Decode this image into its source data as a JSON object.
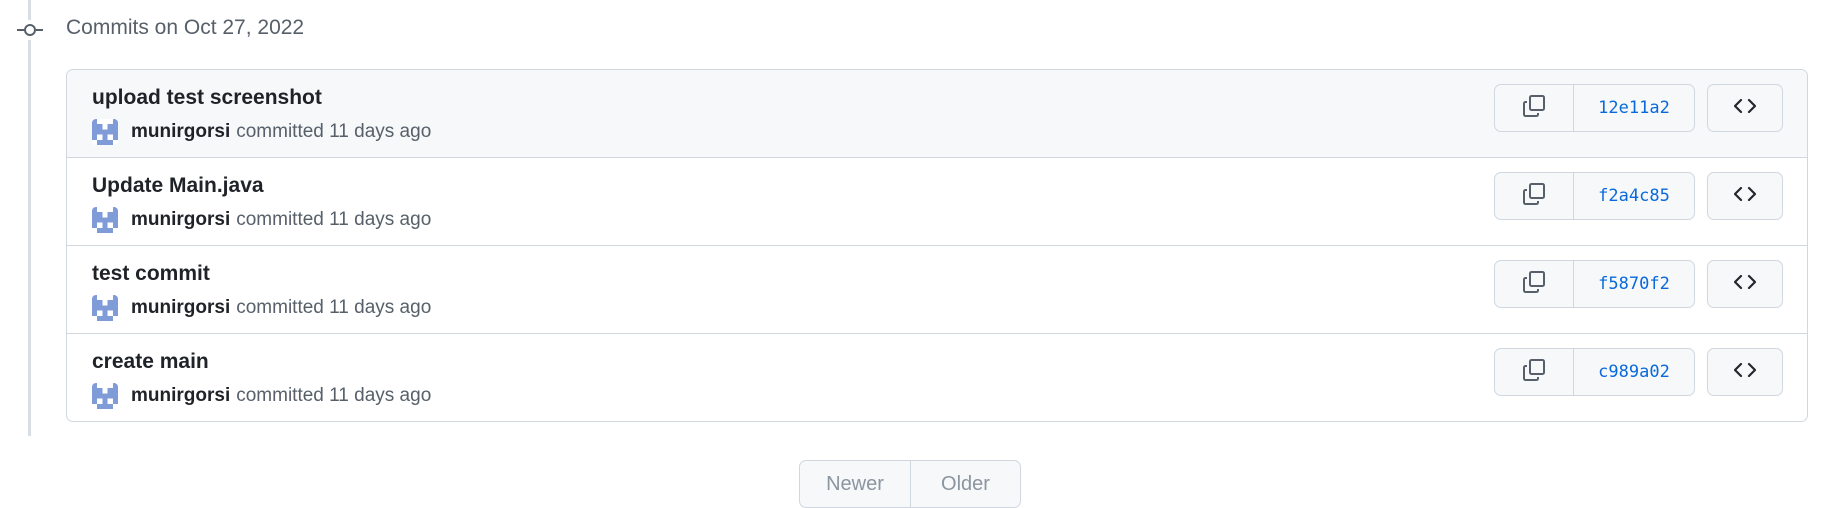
{
  "timeline": {
    "date_header": "Commits on Oct 27, 2022"
  },
  "commits": [
    {
      "title": "upload test screenshot",
      "author": "munirgorsi",
      "meta": "committed 11 days ago",
      "sha": "12e11a2"
    },
    {
      "title": "Update Main.java",
      "author": "munirgorsi",
      "meta": "committed 11 days ago",
      "sha": "f2a4c85"
    },
    {
      "title": "test commit",
      "author": "munirgorsi",
      "meta": "committed 11 days ago",
      "sha": "f5870f2"
    },
    {
      "title": "create main",
      "author": "munirgorsi",
      "meta": "committed 11 days ago",
      "sha": "c989a02"
    }
  ],
  "pagination": {
    "newer_label": "Newer",
    "older_label": "Older"
  },
  "icons": {
    "commit_node": "git-commit-icon",
    "copy": "copy-icon",
    "browse": "code-icon",
    "avatar": "identicon"
  },
  "colors": {
    "link": "#0969da",
    "border": "#d0d7de",
    "muted": "#57606a",
    "avatar": "#7f9cd8"
  }
}
